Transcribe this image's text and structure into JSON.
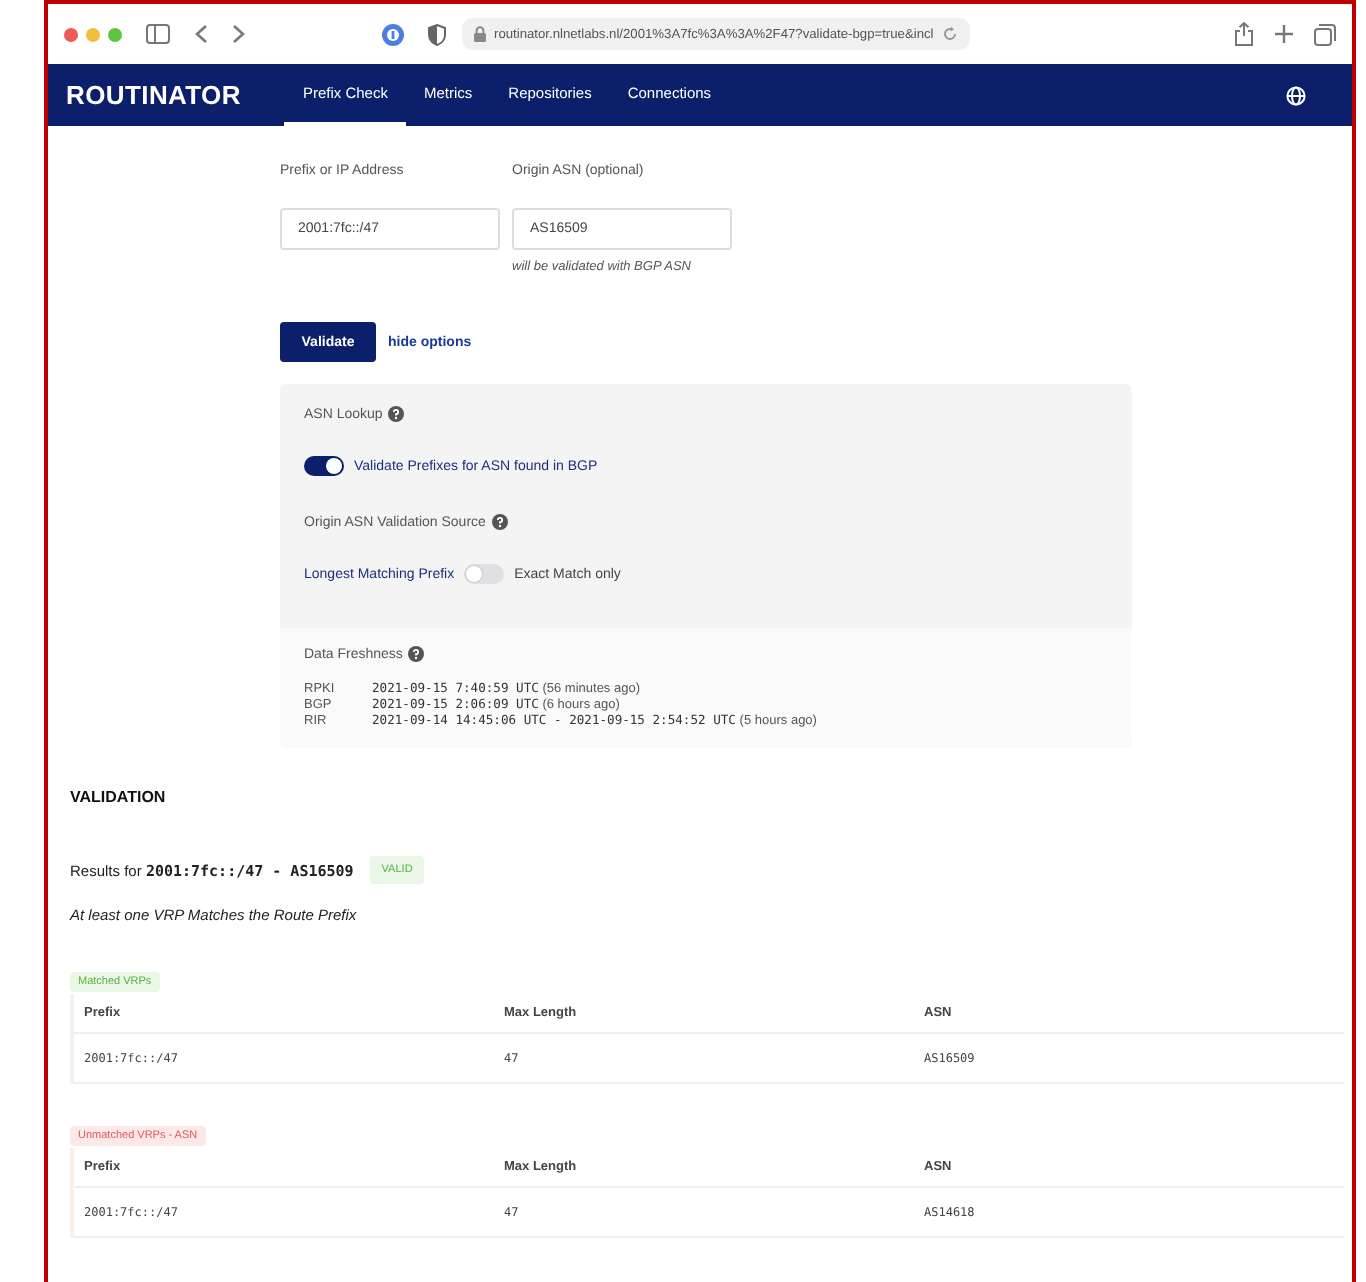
{
  "browser": {
    "url": "routinator.nlnetlabs.nl/2001%3A7fc%3A%3A%2F47?validate-bgp=true&incl"
  },
  "nav": {
    "logo": "ROUTINATOR",
    "items": [
      {
        "label": "Prefix Check",
        "selected": true
      },
      {
        "label": "Metrics",
        "selected": false
      },
      {
        "label": "Repositories",
        "selected": false
      },
      {
        "label": "Connections",
        "selected": false
      }
    ]
  },
  "form": {
    "prefix_label": "Prefix or IP Address",
    "prefix_value": "2001:7fc::/47",
    "asn_label": "Origin ASN (optional)",
    "asn_value": "AS16509",
    "asn_hint": "will be validated with BGP ASN",
    "validate_button": "Validate",
    "hide_options_link": "hide options"
  },
  "options": {
    "asn_lookup_title": "ASN Lookup",
    "bgp_toggle": {
      "on": true,
      "label": "Validate Prefixes for ASN found in BGP"
    },
    "source_title": "Origin ASN Validation Source",
    "source_toggle": {
      "on": false,
      "left_label": "Longest Matching Prefix",
      "right_label": "Exact Match only"
    },
    "freshness_title": "Data Freshness",
    "freshness": [
      {
        "source": "RPKI",
        "time": "2021-09-15 7:40:59 UTC",
        "ago": "(56 minutes ago)"
      },
      {
        "source": "BGP",
        "time": "2021-09-15 2:06:09 UTC",
        "ago": "(6 hours ago)"
      },
      {
        "source": "RIR",
        "time": "2021-09-14 14:45:06 UTC - 2021-09-15 2:54:52 UTC",
        "ago": "(5 hours ago)"
      }
    ]
  },
  "validation": {
    "heading": "VALIDATION",
    "results": "Results for **2001:7fc::/47 - AS16509**",
    "status": "VALID",
    "message": "At least one VRP Matches the Route Prefix",
    "tables": [
      {
        "kind": "matched",
        "label": "Matched VRPs",
        "columns": [
          "Prefix",
          "Max Length",
          "ASN"
        ],
        "rows": [
          [
            "2001:7fc::/47",
            "47",
            "AS16509"
          ]
        ]
      },
      {
        "kind": "unmatched",
        "label": "Unmatched VRPs - ASN",
        "columns": [
          "Prefix",
          "Max Length",
          "ASN"
        ],
        "rows": [
          [
            "2001:7fc::/47",
            "47",
            "AS14618"
          ]
        ]
      }
    ]
  }
}
